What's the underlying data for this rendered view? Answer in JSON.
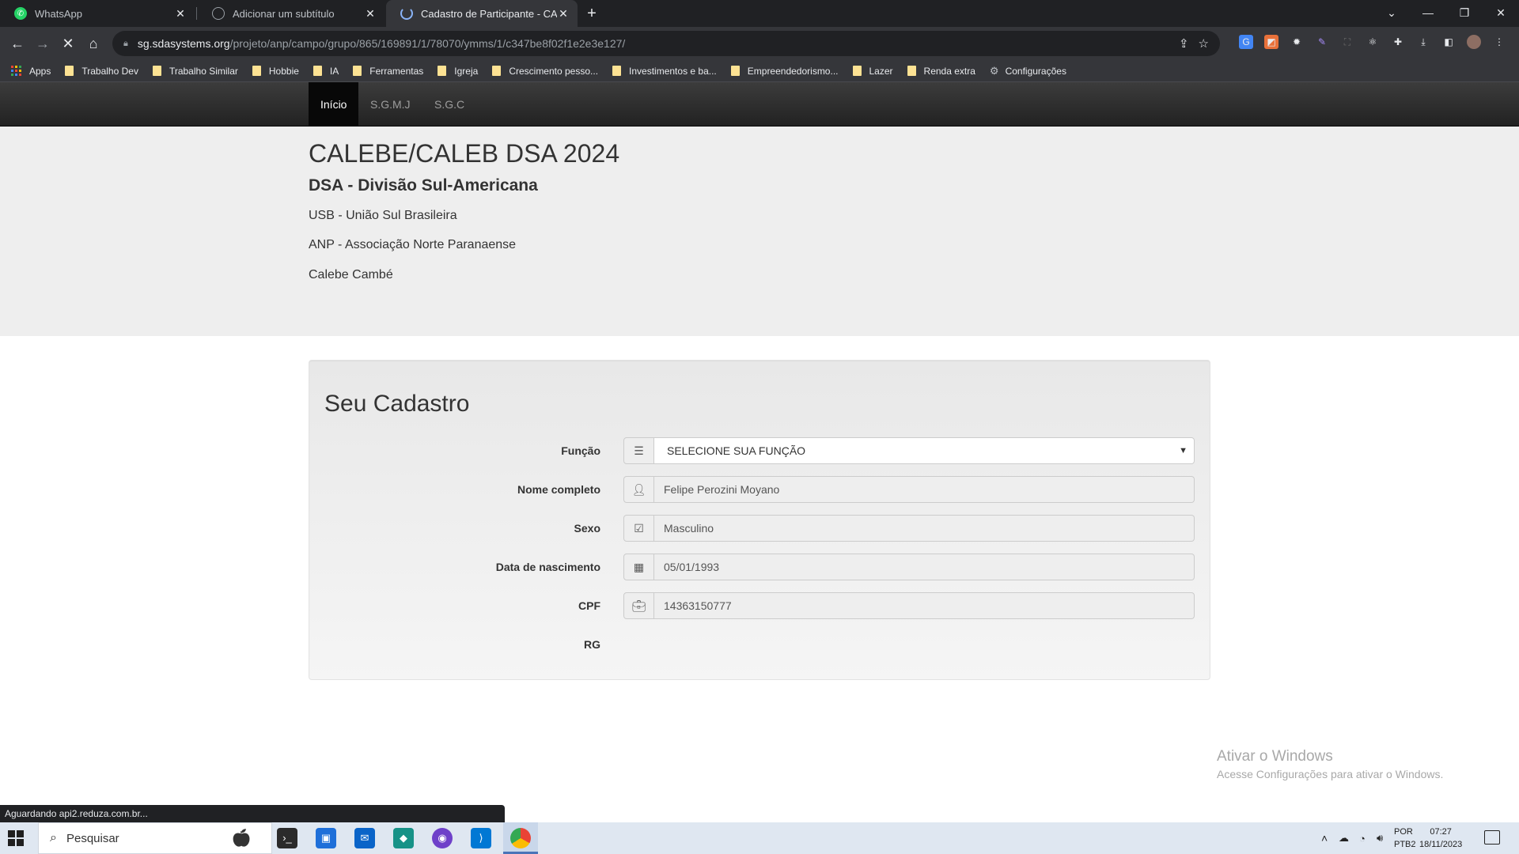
{
  "browser": {
    "tabs": [
      {
        "title": "WhatsApp",
        "favicon": "whatsapp-icon",
        "color": "#25d366",
        "active": false
      },
      {
        "title": "Adicionar um subtítulo",
        "favicon": "globe-icon",
        "color": "#9aa0a6",
        "active": false
      },
      {
        "title": "Cadastro de Participante - CALE",
        "favicon": "loading-icon",
        "color": "#8ab4f8",
        "active": true
      }
    ],
    "new_tab": "+",
    "url_host": "sg.sdasystems.org",
    "url_path": "/projeto/anp/campo/grupo/865/169891/1/78070/ymms/1/c347be8f02f1e2e3e127/",
    "bookmarks": [
      {
        "label": "Apps",
        "type": "apps"
      },
      {
        "label": "Trabalho Dev",
        "type": "folder"
      },
      {
        "label": "Trabalho Similar",
        "type": "folder"
      },
      {
        "label": "Hobbie",
        "type": "folder"
      },
      {
        "label": "IA",
        "type": "folder"
      },
      {
        "label": "Ferramentas",
        "type": "folder"
      },
      {
        "label": "Igreja",
        "type": "folder"
      },
      {
        "label": "Crescimento pesso...",
        "type": "folder"
      },
      {
        "label": "Investimentos e ba...",
        "type": "folder"
      },
      {
        "label": "Empreendedorismo...",
        "type": "folder"
      },
      {
        "label": "Lazer",
        "type": "folder"
      },
      {
        "label": "Renda extra",
        "type": "folder"
      },
      {
        "label": "Configurações",
        "type": "gear"
      }
    ],
    "status_text": "Aguardando api2.reduza.com.br..."
  },
  "site": {
    "nav": [
      {
        "label": "Início",
        "active": true
      },
      {
        "label": "S.G.M.J",
        "active": false
      },
      {
        "label": "S.G.C",
        "active": false
      }
    ],
    "header": {
      "title": "CALEBE/CALEB DSA 2024",
      "division": "DSA - Divisão Sul-Americana",
      "union": "USB - União Sul Brasileira",
      "association": "ANP - Associação Norte Paranaense",
      "group": "Calebe Cambé"
    },
    "form": {
      "title": "Seu Cadastro",
      "fields": [
        {
          "label": "Função",
          "value": "SELECIONE SUA FUNÇÃO",
          "icon": "list-icon",
          "type": "select"
        },
        {
          "label": "Nome completo",
          "value": "Felipe Perozini Moyano",
          "icon": "user-icon",
          "type": "text"
        },
        {
          "label": "Sexo",
          "value": "Masculino",
          "icon": "check-square-icon",
          "type": "text"
        },
        {
          "label": "Data de nascimento",
          "value": "05/01/1993",
          "icon": "calendar-icon",
          "type": "text"
        },
        {
          "label": "CPF",
          "value": "14363150777",
          "icon": "briefcase-icon",
          "type": "text"
        },
        {
          "label": "RG",
          "value": "",
          "icon": "",
          "type": "none"
        }
      ]
    }
  },
  "watermark": {
    "title": "Ativar o Windows",
    "subtitle": "Acesse Configurações para ativar o Windows."
  },
  "taskbar": {
    "search_placeholder": "Pesquisar",
    "language": "POR",
    "layout": "PTB2",
    "time": "07:27",
    "date": "18/11/2023"
  }
}
